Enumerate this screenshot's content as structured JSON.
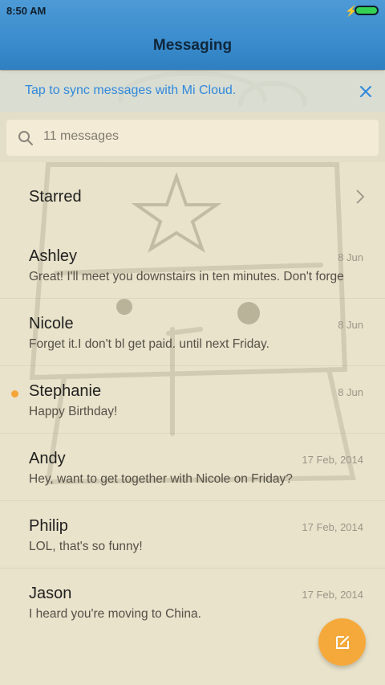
{
  "status_bar": {
    "time": "8:50 AM"
  },
  "header": {
    "title": "Messaging"
  },
  "sync_banner": {
    "text": "Tap to sync messages with Mi Cloud."
  },
  "search": {
    "placeholder": "11 messages"
  },
  "starred": {
    "label": "Starred"
  },
  "conversations": [
    {
      "name": "Ashley",
      "date": "8 Jun",
      "preview": "Great! I'll meet you downstairs in ten minutes. Don't forge",
      "unread": false
    },
    {
      "name": "Nicole",
      "date": "8 Jun",
      "preview": "Forget it.I don't bl get paid. until next Friday.",
      "unread": false
    },
    {
      "name": "Stephanie",
      "date": "8 Jun",
      "preview": "Happy Birthday!",
      "unread": true
    },
    {
      "name": "Andy",
      "date": "17 Feb, 2014",
      "preview": "Hey, want to get together with Nicole on Friday?",
      "unread": false
    },
    {
      "name": "Philip",
      "date": "17 Feb, 2014",
      "preview": "LOL, that's so funny!",
      "unread": false
    },
    {
      "name": "Jason",
      "date": "17 Feb, 2014",
      "preview": "I heard you're moving to China.",
      "unread": false
    }
  ],
  "colors": {
    "accent": "#2f88dd",
    "fab": "#f6a93b",
    "unread_dot": "#f5a536",
    "header": "#3a8ccd"
  },
  "icons": {
    "search": "search-icon",
    "close": "close-icon",
    "chevron": "chevron-right-icon",
    "compose": "compose-icon",
    "battery": "battery-icon",
    "charging": "charging-icon"
  }
}
